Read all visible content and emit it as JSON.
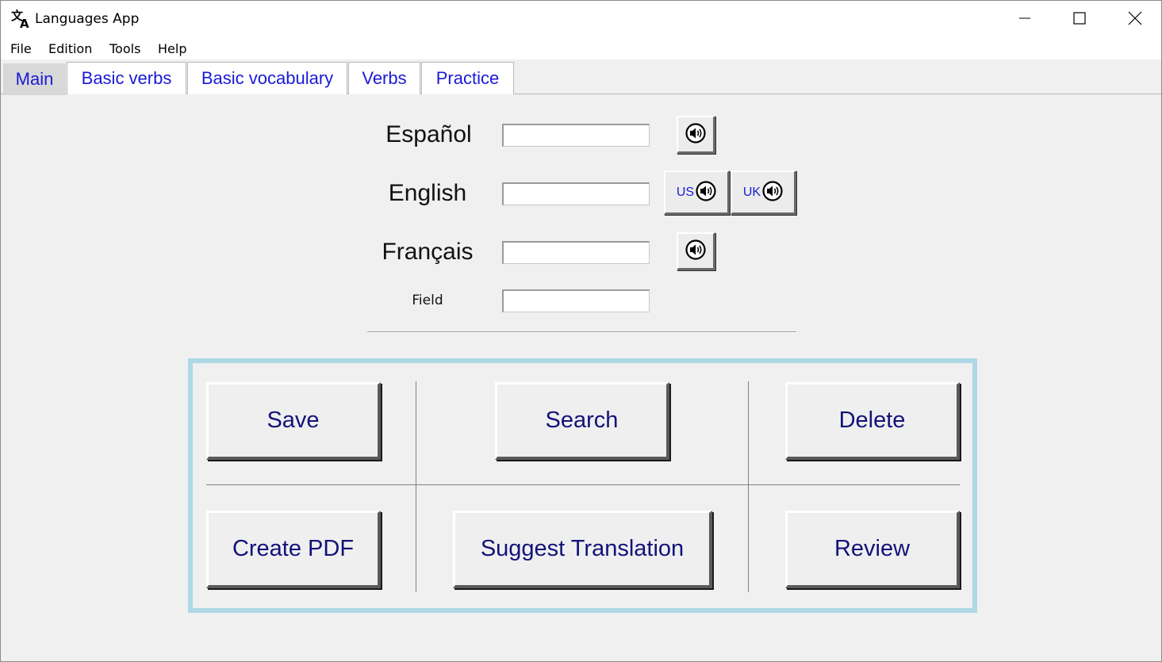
{
  "window": {
    "title": "Languages App",
    "icon": "translate-icon",
    "controls": [
      "minimize-icon",
      "maximize-icon",
      "close-icon"
    ]
  },
  "menu": {
    "items": [
      {
        "label": "File"
      },
      {
        "label": "Edition"
      },
      {
        "label": "Tools"
      },
      {
        "label": "Help"
      }
    ]
  },
  "tabs": [
    {
      "label": "Main",
      "active": true
    },
    {
      "label": "Basic verbs",
      "active": false
    },
    {
      "label": "Basic vocabulary",
      "active": false
    },
    {
      "label": "Verbs",
      "active": false
    },
    {
      "label": "Practice",
      "active": false
    }
  ],
  "form": {
    "espanol": {
      "label": "Español",
      "value": ""
    },
    "english": {
      "label": "English",
      "value": "",
      "us_label": "US",
      "uk_label": "UK"
    },
    "francais": {
      "label": "Français",
      "value": ""
    },
    "field": {
      "label": "Field",
      "value": ""
    }
  },
  "actions": {
    "save": "Save",
    "search": "Search",
    "delete": "Delete",
    "create_pdf": "Create PDF",
    "suggest_translation": "Suggest Translation",
    "review": "Review"
  },
  "colors": {
    "tab_text": "#1a1ad6",
    "button_text": "#12127a",
    "panel_border": "#add8e6",
    "background": "#f0f0f0"
  }
}
